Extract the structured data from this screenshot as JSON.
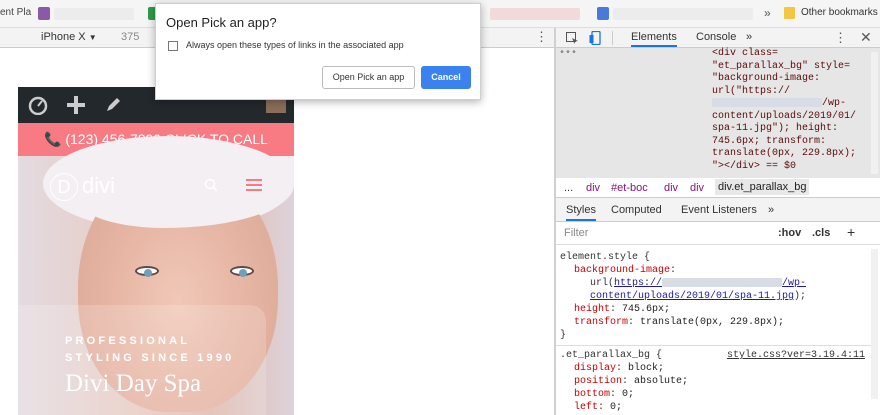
{
  "bookmarks_bar": {
    "left_fragment": "ent Pla",
    "more_chevron": "»",
    "other_bookmarks": "Other bookmarks"
  },
  "device_toolbar": {
    "device": "iPhone X",
    "width": "375"
  },
  "dialog": {
    "title": "Open Pick an app?",
    "checkbox_label": "Always open these types of links in the associated app",
    "open_button": "Open Pick an app",
    "cancel_button": "Cancel"
  },
  "site": {
    "call_text": "(123) 456-7890 CLICK TO CALL",
    "logo": "divi",
    "logo_letter": "D",
    "tagline_1": "PROFESSIONAL",
    "tagline_2": "STYLING SINCE 1990",
    "title": "Divi Day Spa"
  },
  "devtools": {
    "tabs": [
      "Elements",
      "Console"
    ],
    "more": "»",
    "dom_lines": [
      "<div class=",
      "\"et_parallax_bg\" style=",
      "\"background-image:",
      "url(\"https://",
      "content/uploads/2019/01/",
      "spa-11.jpg\"); height:",
      "745.6px; transform:",
      "translate(0px, 229.8px);",
      "\"></div> == $0"
    ],
    "dom_url_tail": "/wp-",
    "breadcrumbs": [
      "...",
      "div",
      "#et-boc",
      "div",
      "div",
      "div.et_parallax_bg"
    ],
    "sub_tabs": [
      "Styles",
      "Computed",
      "Event Listeners",
      "»"
    ],
    "filter_placeholder": "Filter",
    "hov": ":hov",
    "cls": ".cls",
    "plus": "+",
    "element_style": {
      "selector": "element.style {",
      "bg_prop": "background-image",
      "bg_val_start": "url(",
      "url_start": "https://",
      "url_tail": "/wp-",
      "url_line2": "content/uploads/2019/01/spa-11.jpg",
      "url_end": ");",
      "height_prop": "height",
      "height_val": "745.6px;",
      "transform_prop": "transform",
      "transform_val": "translate(0px, 229.8px);",
      "close": "}"
    },
    "rule2": {
      "selector": ".et_parallax_bg {",
      "source": "style.css?ver=3.19.4:11",
      "props": [
        {
          "name": "display",
          "value": "block;"
        },
        {
          "name": "position",
          "value": "absolute;"
        },
        {
          "name": "bottom",
          "value": "0;"
        },
        {
          "name": "left",
          "value": "0;"
        }
      ]
    }
  }
}
